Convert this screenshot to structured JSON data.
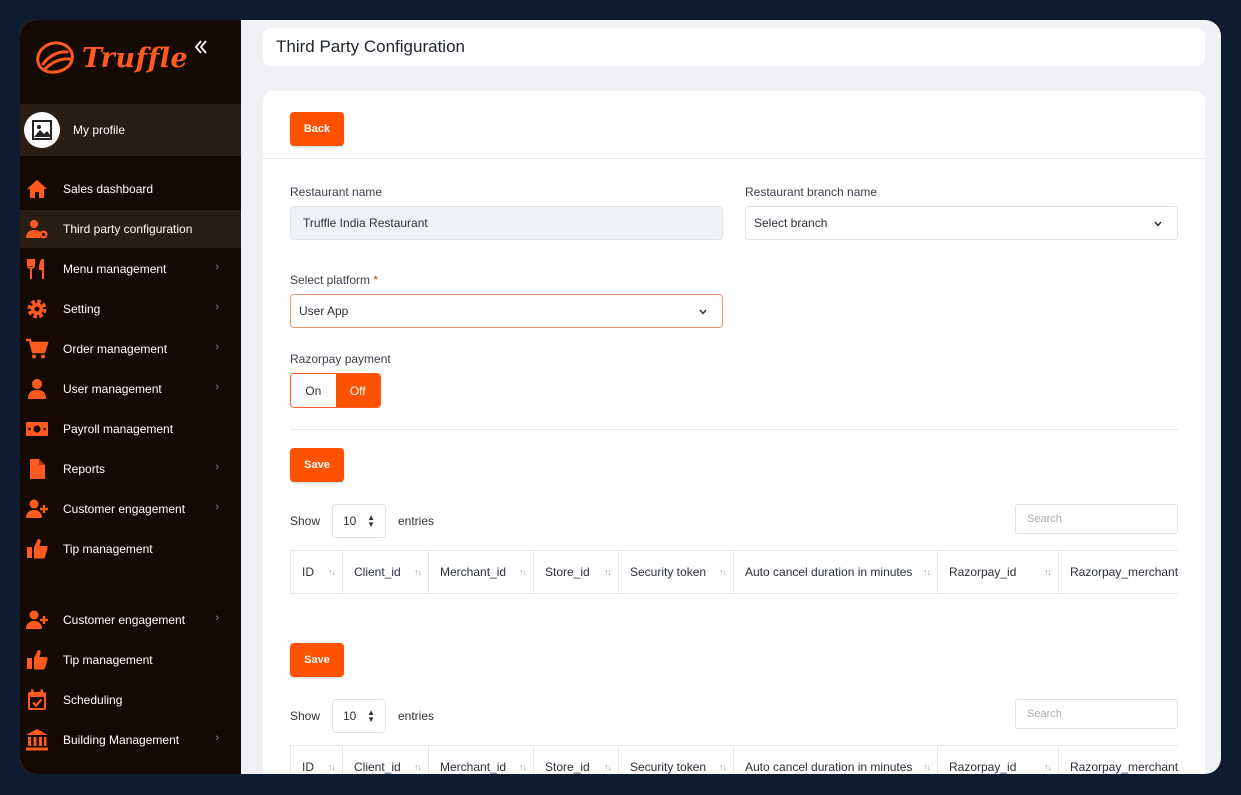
{
  "brand": {
    "name": "Truffle",
    "accent": "#ff5200"
  },
  "sidebar": {
    "profile_label": "My profile",
    "items": [
      {
        "label": "Sales dashboard",
        "icon": "home-icon",
        "chevron": false,
        "active": false
      },
      {
        "label": "Third party configuration",
        "icon": "user-gear-icon",
        "chevron": false,
        "active": true
      },
      {
        "label": "Menu management",
        "icon": "fork-knife-icon",
        "chevron": true,
        "active": false
      },
      {
        "label": "Setting",
        "icon": "gear-icon",
        "chevron": true,
        "active": false
      },
      {
        "label": "Order management",
        "icon": "cart-icon",
        "chevron": true,
        "active": false
      },
      {
        "label": "User management",
        "icon": "user-icon",
        "chevron": true,
        "active": false
      },
      {
        "label": "Payroll management",
        "icon": "money-icon",
        "chevron": false,
        "active": false
      },
      {
        "label": "Reports",
        "icon": "file-icon",
        "chevron": true,
        "active": false
      },
      {
        "label": "Customer engagement",
        "icon": "user-plus-icon",
        "chevron": true,
        "active": false
      },
      {
        "label": "Tip management",
        "icon": "thumbs-up-icon",
        "chevron": false,
        "active": false
      },
      {
        "label": "Customer engagement",
        "icon": "user-plus-icon",
        "chevron": true,
        "active": false
      },
      {
        "label": "Tip management",
        "icon": "thumbs-up-icon",
        "chevron": false,
        "active": false
      },
      {
        "label": "Scheduling",
        "icon": "calendar-check-icon",
        "chevron": false,
        "active": false
      },
      {
        "label": "Building Management",
        "icon": "bank-icon",
        "chevron": true,
        "active": false
      }
    ]
  },
  "header": {
    "title": "Third Party Configuration"
  },
  "form": {
    "back_label": "Back",
    "restaurant_name_label": "Restaurant name",
    "restaurant_name_value": "Truffle India Restaurant",
    "branch_label": "Restaurant branch name",
    "branch_value": "Select branch",
    "platform_label": "Select platform",
    "platform_required": "*",
    "platform_value": "User App",
    "razorpay_label": "Razorpay payment",
    "toggle_on": "On",
    "toggle_off": "Off",
    "toggle_state": "Off",
    "save_label": "Save"
  },
  "tables": [
    {
      "show_label": "Show",
      "entries_value": "10",
      "entries_label": "entries",
      "search_placeholder": "Search",
      "columns": [
        "ID",
        "Client_id",
        "Merchant_id",
        "Store_id",
        "Security token",
        "Auto cancel duration in minutes",
        "Razorpay_id",
        "Razorpay_merchant_"
      ]
    },
    {
      "show_label": "Show",
      "entries_value": "10",
      "entries_label": "entries",
      "search_placeholder": "Search",
      "columns": [
        "ID",
        "Client_id",
        "Merchant_id",
        "Store_id",
        "Security token",
        "Auto cancel duration in minutes",
        "Razorpay_id",
        "Razorpay_merchant_"
      ]
    }
  ]
}
